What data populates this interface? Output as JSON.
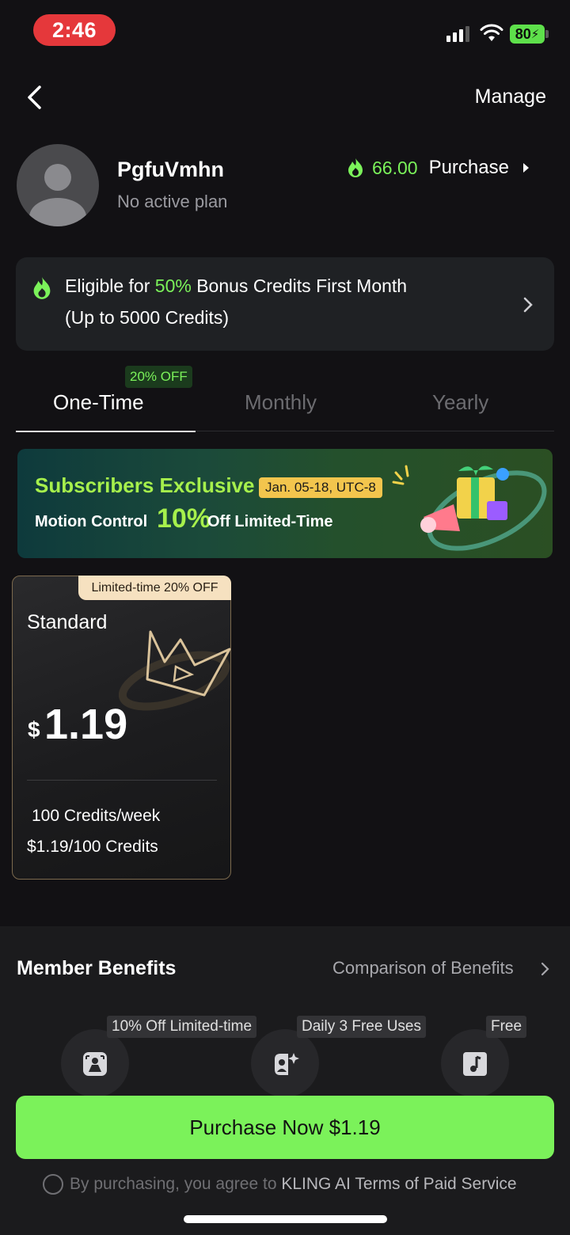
{
  "status_bar": {
    "time": "2:46",
    "battery": "80"
  },
  "header": {
    "manage": "Manage"
  },
  "profile": {
    "username": "PgfuVmhn",
    "plan_status": "No active plan",
    "credits": "66.00",
    "purchase": "Purchase"
  },
  "bonus": {
    "pre": "Eligible for ",
    "highlight": "50%",
    "post": " Bonus Credits First Month",
    "line2": "(Up to 5000 Credits)"
  },
  "tabs": {
    "discount_badge": "20% OFF",
    "items": [
      {
        "label": "One-Time",
        "active": true
      },
      {
        "label": "Monthly",
        "active": false
      },
      {
        "label": "Yearly",
        "active": false
      }
    ]
  },
  "banner": {
    "title": "Subscribers Exclusive",
    "date": "Jan. 05-18, UTC-8",
    "sub_pre": "Motion Control ",
    "pct": "10%",
    "sub_post": "Off Limited-Time"
  },
  "plan": {
    "badge": "Limited-time 20% OFF",
    "name": "Standard",
    "currency": "$",
    "price": "1.19",
    "feature1": "100 Credits/week",
    "feature2": "$1.19/100 Credits"
  },
  "benefits": {
    "title": "Member Benefits",
    "compare": "Comparison of Benefits",
    "items": [
      {
        "tag": "10% Off Limited-time",
        "icon": "motion-frame-icon"
      },
      {
        "tag": "Daily 3 Free Uses",
        "icon": "avatar-sparkle-icon"
      },
      {
        "tag": "Free",
        "icon": "music-note-icon"
      }
    ]
  },
  "purchase_button": "Purchase Now $1.19",
  "agreement": {
    "text": "By purchasing, you agree to ",
    "link": "KLING AI Terms of Paid Service"
  },
  "colors": {
    "accent": "#7bf25a",
    "background": "#121114",
    "gold": "#f3c54d"
  }
}
